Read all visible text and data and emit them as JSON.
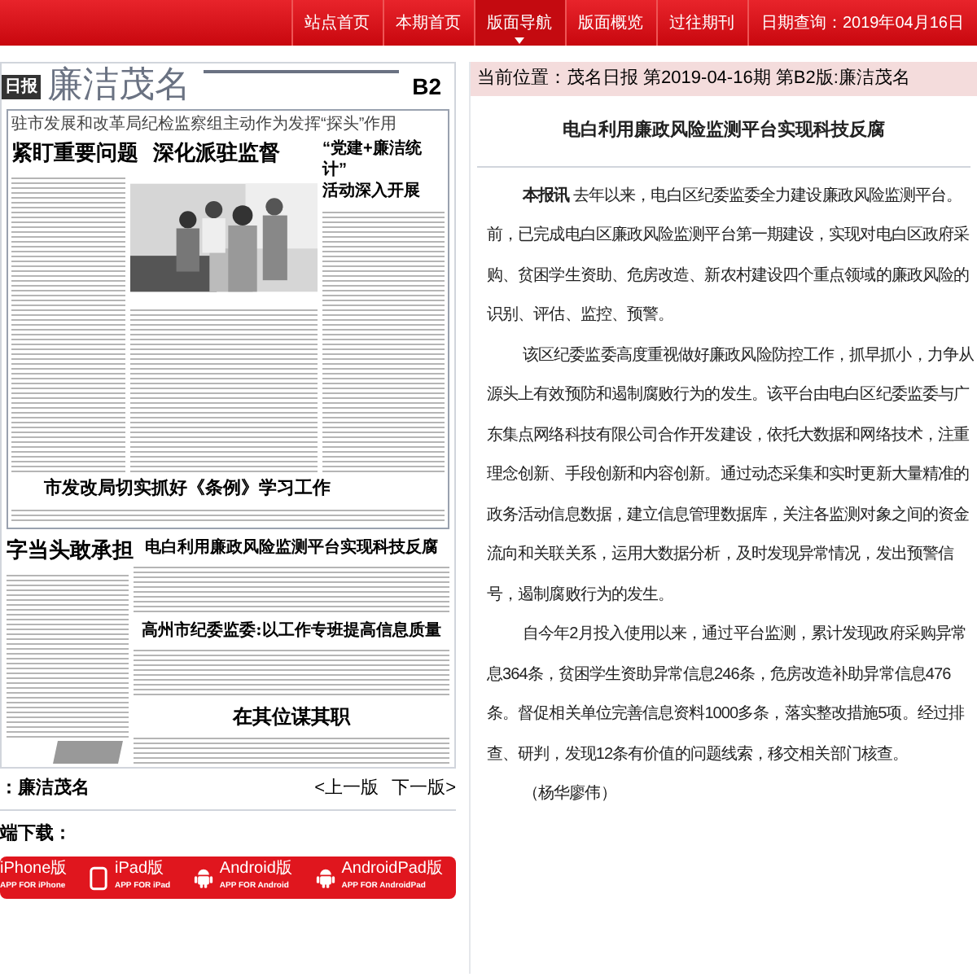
{
  "nav": {
    "items": [
      {
        "label": "站点首页",
        "selected": false
      },
      {
        "label": "本期首页",
        "selected": false
      },
      {
        "label": "版面导航",
        "selected": true
      },
      {
        "label": "版面概览",
        "selected": false
      },
      {
        "label": "过往期刊",
        "selected": false
      }
    ],
    "date": "日期查询：2019年04月16日"
  },
  "paper": {
    "masthead_logo": "日报",
    "section": "廉洁茂名",
    "page": "B2",
    "lead_subtitle": "驻市发展和改革局纪检监察组主动作为发挥“探头”作用",
    "lead_headline": "紧盯重要问题  深化派驻监督",
    "side_headline": [
      "“党建+廉洁统计”",
      "活动深入开展"
    ],
    "second_headline": "市发改局切实抓好《条例》学习工作",
    "left_headline": "字当头敢承担",
    "story_headlines": [
      "电白利用廉政风险监测平台实现科技反腐",
      "高州市纪委监委:以工作专班提高信息质量"
    ],
    "bottom_headline": "在其位谋其职"
  },
  "page_nav": {
    "label": "：廉洁茂名",
    "prev": "<上一版",
    "next": "下一版>"
  },
  "download": {
    "label": "端下载：",
    "apps": [
      {
        "name": "iPhone版",
        "sub": "APP FOR iPhone",
        "kind": "text_only"
      },
      {
        "name": "iPad版",
        "sub": "APP FOR iPad",
        "kind": "tablet"
      },
      {
        "name": "Android版",
        "sub": "APP FOR Android",
        "kind": "android"
      },
      {
        "name": "AndroidPad版",
        "sub": "APP FOR AndroidPad",
        "kind": "android"
      }
    ]
  },
  "article": {
    "breadcrumb": "当前位置：茂名日报 第2019-04-16期 第B2版:廉洁茂名",
    "title": "电白利用廉政风险监测平台实现科技反腐",
    "paragraphs": [
      {
        "lines": [
          "**本报讯** 去年以来，电白区纪委监委全力建设廉政风险监测平台。",
          "前，已完成电白区廉政风险监测平台第一期建设，实现对电白区政府采",
          "购、贫困学生资助、危房改造、新农村建设四个重点领域的廉政风险的",
          "识别、评估、监控、预警。"
        ]
      },
      {
        "lines": [
          "该区纪委监委高度重视做好廉政风险防控工作，抓早抓小，力争从",
          "源头上有效预防和遏制腐败行为的发生。该平台由电白区纪委监委与广",
          "东集点网络科技有限公司合作开发建设，依托大数据和网络技术，注重",
          "理念创新、手段创新和内容创新。通过动态采集和实时更新大量精准的",
          "政务活动信息数据，建立信息管理数据库，关注各监测对象之间的资金",
          "流向和关联关系，运用大数据分析，及时发现异常情况，发出预警信",
          "号，遏制腐败行为的发生。"
        ]
      },
      {
        "lines": [
          "自今年2月投入使用以来，通过平台监测，累计发现政府采购异常",
          "息364条，贫困学生资助异常信息246条，危房改造补助异常信息476",
          "条。督促相关单位完善信息资料1000多条，落实整改措施5项。经过排",
          "查、研判，发现12条有价值的问题线索，移交相关部门核查。"
        ]
      },
      {
        "lines": [
          "（杨华廖伟）"
        ]
      }
    ]
  }
}
